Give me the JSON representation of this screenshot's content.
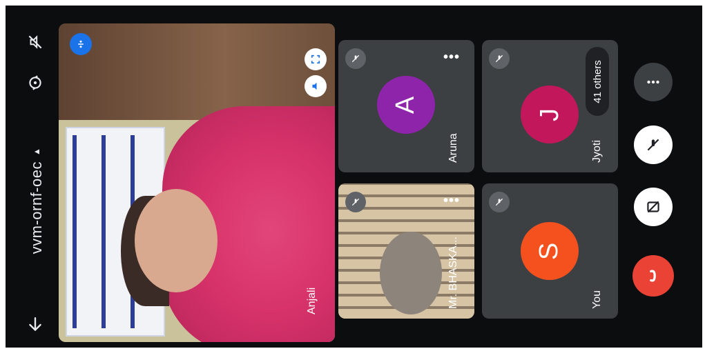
{
  "toolbar": {
    "meeting_code": "vvm-ornf-oec",
    "icons": [
      "back-arrow-icon",
      "caret-down-icon",
      "switch-camera-icon",
      "audio-output-off-icon"
    ]
  },
  "main_tile": {
    "name": "Anjali",
    "icons": [
      "pin-icon",
      "fullscreen-icon",
      "speaker-icon"
    ]
  },
  "participants": [
    {
      "id": "aruna",
      "name": "Aruna",
      "initial": "A",
      "color": "#8e24aa"
    },
    {
      "id": "bhaskar",
      "name": "Mr. BHASKA..."
    },
    {
      "id": "jyoti",
      "name": "Jyoti",
      "initial": "J",
      "color": "#c2185b"
    },
    {
      "id": "you",
      "name": "You",
      "initial": "S",
      "color": "#f4511e"
    }
  ],
  "others_count_label": "41 others",
  "controls": {
    "icons": [
      "more-options-icon",
      "mic-off-icon",
      "camera-off-icon",
      "end-call-icon"
    ],
    "end_call_color": "#ea4335"
  }
}
